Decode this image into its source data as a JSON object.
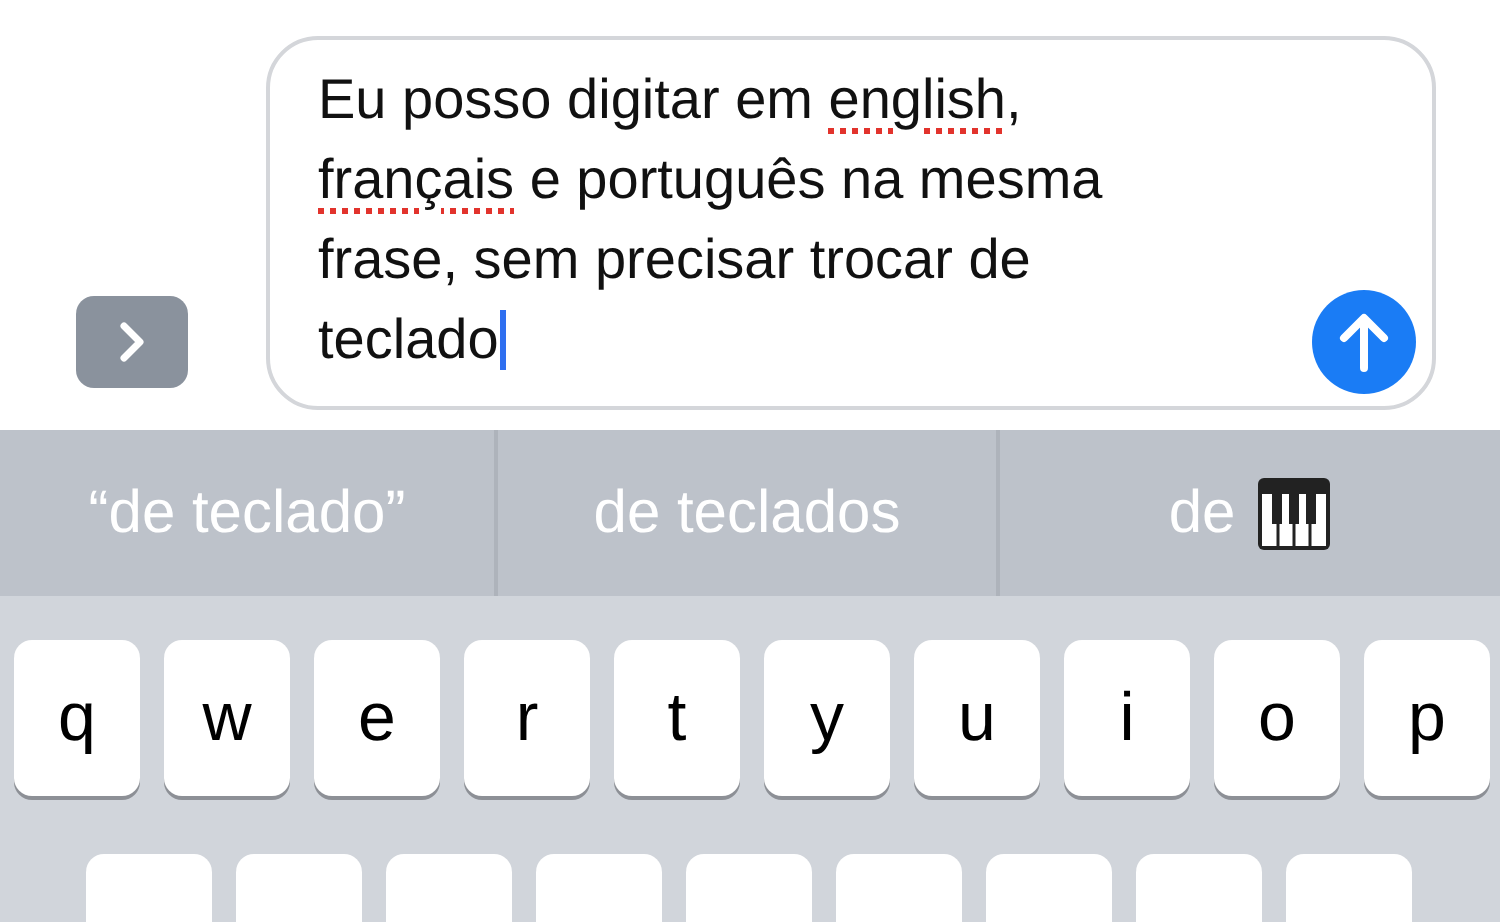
{
  "message_field": {
    "lines": [
      [
        {
          "text": "Eu posso digitar em ",
          "misspelled": false
        },
        {
          "text": "english",
          "misspelled": true
        },
        {
          "text": ",",
          "misspelled": false
        }
      ],
      [
        {
          "text": "français",
          "misspelled": true
        },
        {
          "text": " e português na mesma",
          "misspelled": false
        }
      ],
      [
        {
          "text": "frase, sem precisar trocar de",
          "misspelled": false
        }
      ],
      [
        {
          "text": "teclado",
          "misspelled": false
        }
      ]
    ]
  },
  "suggestions": [
    {
      "text": "“de teclado”",
      "kind": "plain"
    },
    {
      "text": "de teclados",
      "kind": "plain"
    },
    {
      "text": "de",
      "kind": "emoji"
    }
  ],
  "keyboard": {
    "row_1": [
      "q",
      "w",
      "e",
      "r",
      "t",
      "y",
      "u",
      "i",
      "o",
      "p"
    ],
    "row_2": [
      {
        "kind": "cut_off"
      },
      {
        "kind": "cut_off"
      },
      {
        "kind": "cut_off"
      },
      {
        "kind": "cut_off"
      },
      {
        "kind": "cut_off"
      },
      {
        "kind": "cut_off"
      },
      {
        "kind": "cut_off"
      },
      {
        "kind": "cut_off"
      },
      {
        "kind": "cut_off"
      }
    ]
  }
}
